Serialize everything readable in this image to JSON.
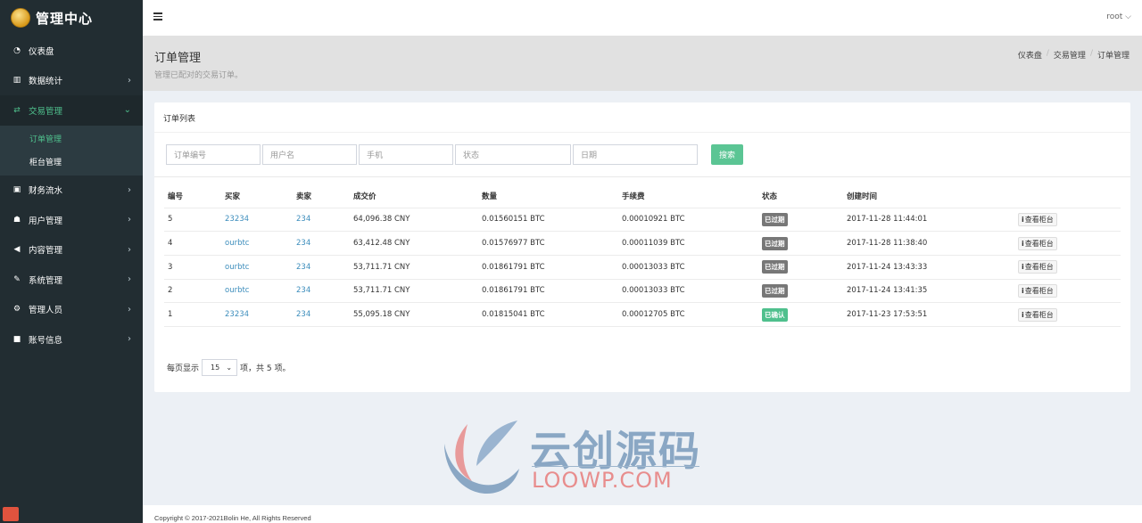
{
  "brand": {
    "title": "管理中心"
  },
  "sidebar": {
    "items": [
      {
        "label": "仪表盘",
        "icon": "dashboard-icon",
        "glyph": "◔",
        "has_children": false
      },
      {
        "label": "数据统计",
        "icon": "bar-chart-icon",
        "glyph": "▥",
        "has_children": true
      },
      {
        "label": "交易管理",
        "icon": "exchange-icon",
        "glyph": "⇄",
        "has_children": true,
        "active": true,
        "children": [
          {
            "label": "订单管理",
            "current": true
          },
          {
            "label": "柜台管理"
          }
        ]
      },
      {
        "label": "财务流水",
        "icon": "money-icon",
        "glyph": "▣",
        "has_children": true
      },
      {
        "label": "用户管理",
        "icon": "users-icon",
        "glyph": "☗",
        "has_children": true
      },
      {
        "label": "内容管理",
        "icon": "bullhorn-icon",
        "glyph": "◀",
        "has_children": true
      },
      {
        "label": "系统管理",
        "icon": "wrench-icon",
        "glyph": "✎",
        "has_children": true
      },
      {
        "label": "管理人员",
        "icon": "cogs-icon",
        "glyph": "⚙",
        "has_children": true
      },
      {
        "label": "账号信息",
        "icon": "lock-icon",
        "glyph": "■",
        "has_children": true
      }
    ]
  },
  "header": {
    "user": "root",
    "user_caret": "⌵"
  },
  "content_header": {
    "title": "订单管理",
    "subtitle": "管理已配对的交易订单。",
    "breadcrumb": [
      "仪表盘",
      "交易管理",
      "订单管理"
    ]
  },
  "box": {
    "title": "订单列表",
    "filters": {
      "order_no_placeholder": "订单编号",
      "username_placeholder": "用户名",
      "phone_placeholder": "手机",
      "status_placeholder": "状态",
      "date_placeholder": "日期",
      "search_label": "搜索"
    },
    "table": {
      "headers": [
        "编号",
        "买家",
        "卖家",
        "成交价",
        "数量",
        "手续费",
        "状态",
        "创建时间",
        ""
      ],
      "rows": [
        {
          "id": "5",
          "buyer": "23234",
          "seller": "234",
          "price": "64,096.38 CNY",
          "amount": "0.01560151 BTC",
          "fee": "0.00010921 BTC",
          "status": "已过期",
          "status_color": "#777777",
          "created": "2017-11-28 11:44:01",
          "action": "查看柜台"
        },
        {
          "id": "4",
          "buyer": "ourbtc",
          "seller": "234",
          "price": "63,412.48 CNY",
          "amount": "0.01576977 BTC",
          "fee": "0.00011039 BTC",
          "status": "已过期",
          "status_color": "#777777",
          "created": "2017-11-28 11:38:40",
          "action": "查看柜台"
        },
        {
          "id": "3",
          "buyer": "ourbtc",
          "seller": "234",
          "price": "53,711.71 CNY",
          "amount": "0.01861791 BTC",
          "fee": "0.00013033 BTC",
          "status": "已过期",
          "status_color": "#777777",
          "created": "2017-11-24 13:43:33",
          "action": "查看柜台"
        },
        {
          "id": "2",
          "buyer": "ourbtc",
          "seller": "234",
          "price": "53,711.71 CNY",
          "amount": "0.01861791 BTC",
          "fee": "0.00013033 BTC",
          "status": "已过期",
          "status_color": "#777777",
          "created": "2017-11-24 13:41:35",
          "action": "查看柜台"
        },
        {
          "id": "1",
          "buyer": "23234",
          "seller": "234",
          "price": "55,095.18 CNY",
          "amount": "0.01815041 BTC",
          "fee": "0.00012705 BTC",
          "status": "已确认",
          "status_color": "#4fc08d",
          "created": "2017-11-23 17:53:51",
          "action": "查看柜台"
        }
      ]
    },
    "paging": {
      "prefix": "每页显示",
      "page_size": "15",
      "suffix": "项，共 5 项。"
    }
  },
  "watermark": {
    "cn": "云创源码",
    "en": "LOOWP.COM"
  },
  "footer": {
    "copyright": "Copyright © 2017-2021Bolin He, All Rights Reserved"
  },
  "colors": {
    "accent": "#4fc08d",
    "sidebar_bg": "#222d32",
    "link": "#3c8dbc"
  }
}
